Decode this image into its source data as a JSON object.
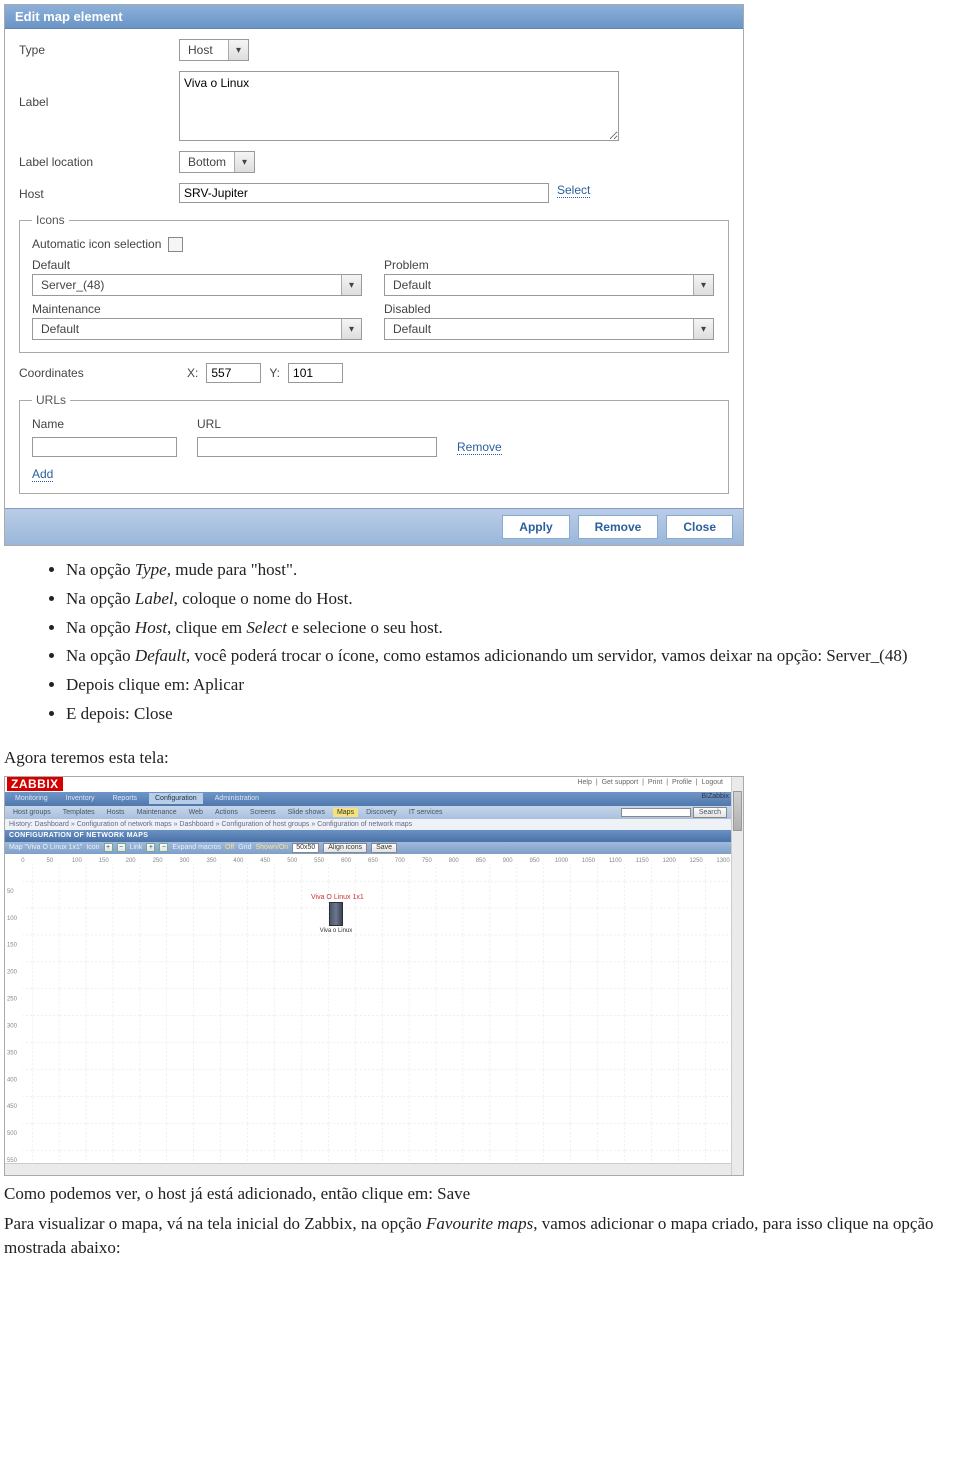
{
  "dialog": {
    "title": "Edit map element",
    "labels": {
      "type": "Type",
      "label": "Label",
      "label_location": "Label location",
      "host": "Host",
      "icons_legend": "Icons",
      "auto_icon": "Automatic icon selection",
      "default": "Default",
      "problem": "Problem",
      "maintenance": "Maintenance",
      "disabled": "Disabled",
      "coordinates": "Coordinates",
      "x": "X:",
      "y": "Y:",
      "urls_legend": "URLs",
      "url_name": "Name",
      "url_url": "URL",
      "remove_link": "Remove",
      "add_link": "Add",
      "select_link": "Select"
    },
    "values": {
      "type": "Host",
      "label": "Viva o Linux",
      "label_location": "Bottom",
      "host": "SRV-Jupiter",
      "icon_default": "Server_(48)",
      "icon_problem": "Default",
      "icon_maintenance": "Default",
      "icon_disabled": "Default",
      "x": "557",
      "y": "101",
      "url_name_val": "",
      "url_url_val": ""
    },
    "buttons": {
      "apply": "Apply",
      "remove": "Remove",
      "close": "Close"
    }
  },
  "instructions": {
    "items": [
      {
        "pre": "Na opção ",
        "em1": "Type",
        "post": ", mude para \"host\"."
      },
      {
        "pre": "Na opção ",
        "em1": "Label",
        "post": ", coloque o nome do Host."
      },
      {
        "pre": "Na opção ",
        "em1": "Host",
        "mid": ", clique em ",
        "em2": "Select",
        "post": " e selecione o seu host."
      },
      {
        "pre": "Na opção ",
        "em1": "Default",
        "post": ", você poderá trocar o ícone, como estamos adicionando um servidor, vamos deixar na opção: Server_(48)"
      },
      {
        "plain": "Depois clique em: Aplicar"
      },
      {
        "plain": "E depois: Close"
      }
    ],
    "after1": "Agora teremos esta tela:",
    "after2": "Como podemos ver, o host já está adicionado, então clique em: Save",
    "after3a": "Para visualizar o mapa, vá na tela inicial do Zabbix, na opção ",
    "after3em": "Favourite maps",
    "after3b": ", vamos adicionar o mapa criado, para isso clique na opção mostrada abaixo:"
  },
  "map": {
    "brand": "ZABBIX",
    "toplinks": [
      "Help",
      "Get support",
      "Print",
      "Profile",
      "Logout"
    ],
    "corp": "BIZabbix",
    "nav1": [
      "Monitoring",
      "Inventory",
      "Reports"
    ],
    "nav1_active": "Configuration",
    "nav1_after": [
      "Administration"
    ],
    "nav2": [
      "Host groups",
      "Templates",
      "Hosts",
      "Maintenance",
      "Web",
      "Actions",
      "Screens",
      "Slide shows"
    ],
    "nav2_hl": "Maps",
    "nav2_after": [
      "Discovery",
      "IT services"
    ],
    "search_btn": "Search",
    "history": "History:  Dashboard » Configuration of network maps » Dashboard » Configuration of host groups » Configuration of network maps",
    "section": "CONFIGURATION OF NETWORK MAPS",
    "toolbar": {
      "map_label": "Map \"Viva O Linux 1x1\"",
      "icon_label": "Icon",
      "link_label": "Link",
      "expand_label": "Expand macros",
      "expand_val": "Off",
      "grid_label": "Grid",
      "grid_val": "Shown/On",
      "grid_size": "50x50",
      "align_btn": "Align icons",
      "save_btn": "Save"
    },
    "ruler_x": [
      "0",
      "50",
      "100",
      "150",
      "200",
      "250",
      "300",
      "350",
      "400",
      "450",
      "500",
      "550",
      "600",
      "650",
      "700",
      "750",
      "800",
      "850",
      "900",
      "950",
      "1000",
      "1050",
      "1100",
      "1150",
      "1200",
      "1250",
      "1300"
    ],
    "ruler_y": [
      "50",
      "100",
      "150",
      "200",
      "250",
      "300",
      "350",
      "400",
      "450",
      "500",
      "550"
    ],
    "host_label_top": "Viva O Linux  1x1",
    "host_label_bot": "Viva o Linux"
  }
}
